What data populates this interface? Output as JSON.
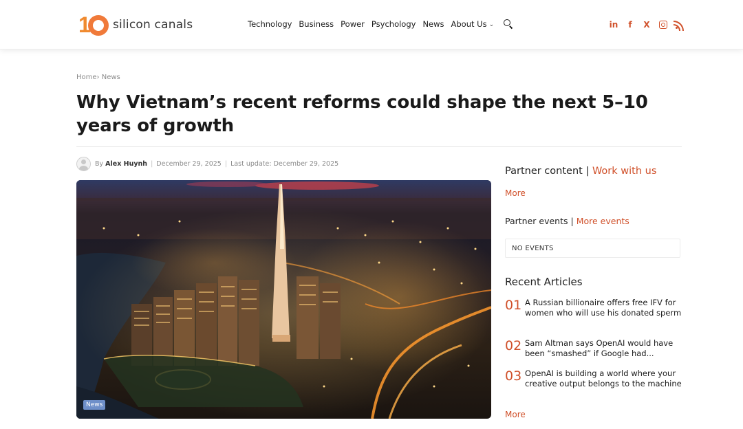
{
  "brand": {
    "logo_number": "1",
    "name": "silicon canals",
    "accent_color": "#f07a3a"
  },
  "nav": {
    "items": [
      "Technology",
      "Business",
      "Power",
      "Psychology",
      "News",
      "About Us"
    ],
    "search_icon": "search-icon"
  },
  "social": {
    "linkedin": "in",
    "facebook": "f",
    "x": "X",
    "icons": [
      "linkedin-icon",
      "facebook-icon",
      "x-icon",
      "instagram-icon",
      "rss-icon"
    ],
    "color": "#d0502a"
  },
  "breadcrumb": {
    "home": "Home",
    "separator": "›",
    "section": "News"
  },
  "article": {
    "title": "Why Vietnam’s recent reforms could shape the next 5–10 years of growth",
    "by": "By",
    "author": "Alex Huynh",
    "date": "December 29, 2025",
    "last_update_label": "Last update:",
    "last_update": "December 29, 2025",
    "category_badge": "News"
  },
  "sidebar": {
    "partner_label": "Partner content",
    "partner_sep": "|",
    "work_with_us": "Work with us",
    "more": "More",
    "events_label": "Partner events",
    "events_sep": "|",
    "more_events": "More events",
    "no_events": "NO EVENTS",
    "recent_heading": "Recent Articles",
    "recent": [
      {
        "num": "01",
        "title": "A Russian billionaire offers free IFV for women who will use his donated sperm"
      },
      {
        "num": "02",
        "title": "Sam Altman says OpenAI would have been “smashed” if Google had..."
      },
      {
        "num": "03",
        "title": "OpenAI is building a world where your creative output belongs to the machine"
      }
    ],
    "recent_more": "More"
  }
}
